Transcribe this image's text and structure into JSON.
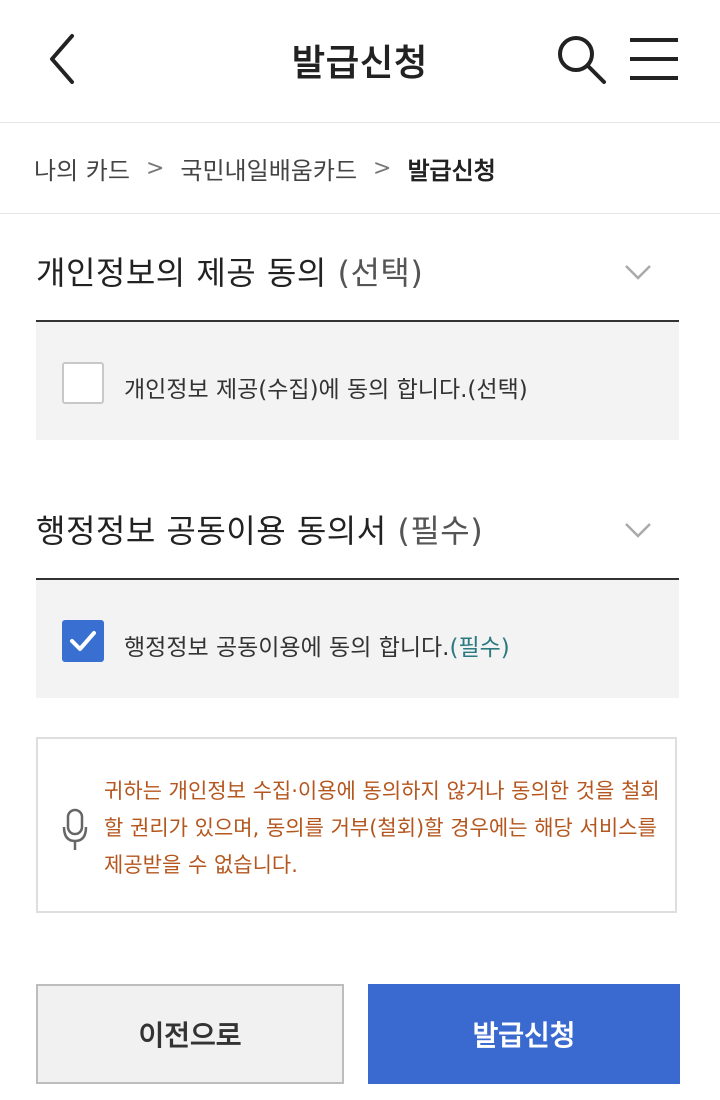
{
  "header": {
    "title": "발급신청",
    "back_icon": "chevron-left-icon",
    "search_icon": "search-icon",
    "menu_icon": "hamburger-menu-icon"
  },
  "breadcrumb": {
    "items": [
      "나의 카드",
      "국민내일배움카드",
      "발급신청"
    ],
    "separator": ">"
  },
  "sections": [
    {
      "title": "개인정보의 제공 동의",
      "tag": "(선택)",
      "checkbox_label": "개인정보 제공(수집)에 동의 합니다.(선택)",
      "checked": false
    },
    {
      "title": "행정정보 공동이용 동의서",
      "tag": "(필수)",
      "checkbox_label_main": "행정정보 공동이용에 동의 합니다.",
      "checkbox_label_req": "(필수)",
      "checked": true
    }
  ],
  "notice": {
    "icon": "microphone-icon",
    "text": "귀하는 개인정보 수집·이용에 동의하지 않거나 동의한 것을 철회할 권리가 있으며, 동의를 거부(철회)할 경우에는 해당 서비스를 제공받을 수 없습니다."
  },
  "buttons": {
    "prev": "이전으로",
    "submit": "발급신청"
  },
  "colors": {
    "primary": "#3a69cf",
    "notice_text": "#b4561e",
    "required_text": "#2a7a80"
  }
}
